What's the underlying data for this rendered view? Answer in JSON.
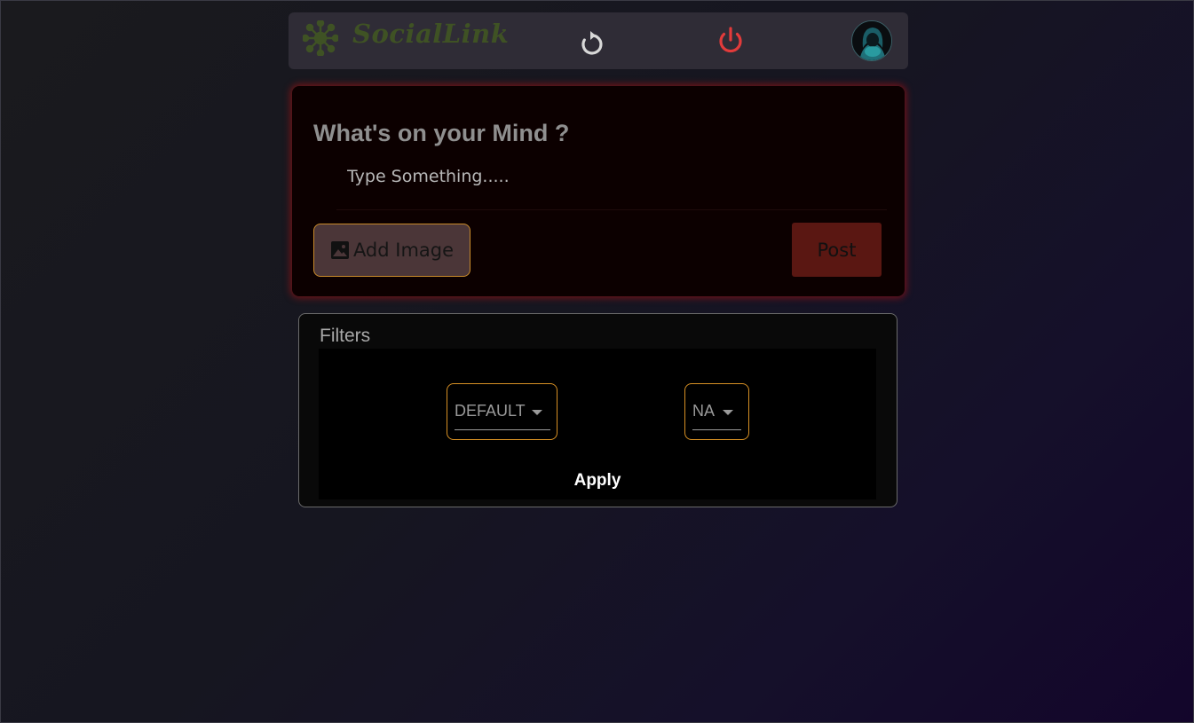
{
  "navbar": {
    "logo_text": "SocialLink",
    "icons": {
      "logo": "atom-network-icon",
      "refresh": "refresh-icon",
      "logout": "power-icon",
      "avatar": "hooded-user-avatar"
    },
    "colors": {
      "logo": "#3f5224",
      "power": "#e23b3b",
      "refresh": "#d8d8d8"
    }
  },
  "post": {
    "title": "What's on your Mind ?",
    "placeholder": "Type Something.....",
    "add_image_label": "Add Image",
    "post_label": "Post",
    "colors": {
      "glow": "#be1010",
      "post_button": "#5a1712",
      "add_image_border": "#c98a2a"
    }
  },
  "filters": {
    "title": "Filters",
    "sort_value": "DEFAULT",
    "category_value": "NA",
    "apply_label": "Apply",
    "colors": {
      "select_border": "#d69024"
    }
  }
}
